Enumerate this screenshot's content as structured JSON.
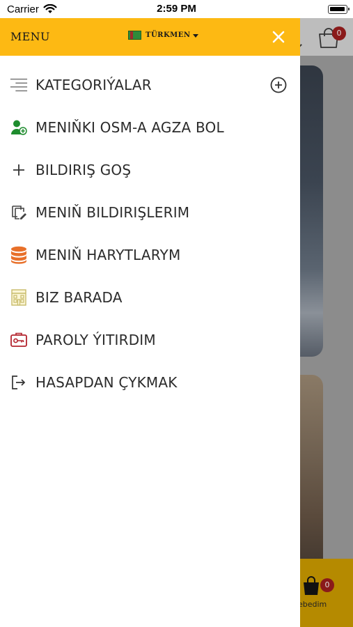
{
  "status_bar": {
    "carrier": "Carrier",
    "time": "2:59 PM"
  },
  "drawer": {
    "title": "MENU",
    "language": "TÜRKMEN",
    "accent_color": "#fdb913",
    "items": [
      {
        "label": "KATEGORIÝALAR",
        "icon": "list-lines-icon"
      },
      {
        "label": "MENIŇKI OSM-A AGZA BOL",
        "icon": "add-user-icon"
      },
      {
        "label": "BILDIRIŞ GOŞ",
        "icon": "plus-icon"
      },
      {
        "label": "MENIŇ BILDIRIŞLERIM",
        "icon": "edit-document-icon"
      },
      {
        "label": "MENIŇ HARYTLARYM",
        "icon": "database-icon"
      },
      {
        "label": "BIZ BARADA",
        "icon": "building-icon"
      },
      {
        "label": "PAROLY ÝITIRDIM",
        "icon": "key-card-icon"
      },
      {
        "label": "HASAPDAN ÇYKMAK",
        "icon": "logout-icon"
      }
    ]
  },
  "background": {
    "cart_count": "0",
    "bag_count": "0",
    "bottom_label": "ebedim"
  }
}
